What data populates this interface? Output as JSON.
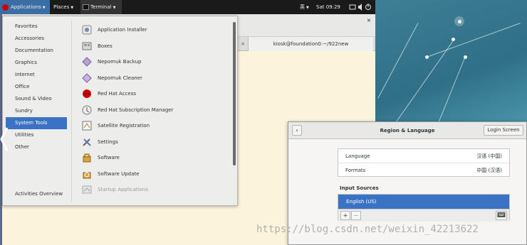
{
  "topbar": {
    "applications_label": "Applications",
    "places_label": "Places",
    "terminal_label": "Terminal",
    "input_method": "英",
    "clock": "Sat 09:29"
  },
  "terminal": {
    "tab_title": "kiosk@foundation0:~/922new",
    "tab_close": "×",
    "close_glyph": "×"
  },
  "menu": {
    "categories": [
      "Favorites",
      "Accessories",
      "Documentation",
      "Graphics",
      "Internet",
      "Office",
      "Sound & Video",
      "Sundry",
      "System Tools",
      "Utilities",
      "Other"
    ],
    "selected_category": "System Tools",
    "activities_overview": "Activities Overview",
    "apps": [
      {
        "label": "Application Installer",
        "icon": "installer-icon",
        "enabled": true
      },
      {
        "label": "Boxes",
        "icon": "boxes-icon",
        "enabled": true
      },
      {
        "label": "Nepomuk Backup",
        "icon": "nepomuk-backup-icon",
        "enabled": true
      },
      {
        "label": "Nepomuk Cleaner",
        "icon": "nepomuk-cleaner-icon",
        "enabled": true
      },
      {
        "label": "Red Hat Access",
        "icon": "redhat-icon",
        "enabled": true
      },
      {
        "label": "Red Hat Subscription Manager",
        "icon": "subscription-icon",
        "enabled": true
      },
      {
        "label": "Satellite Registration",
        "icon": "satellite-icon",
        "enabled": true
      },
      {
        "label": "Settings",
        "icon": "settings-icon",
        "enabled": true
      },
      {
        "label": "Software",
        "icon": "software-icon",
        "enabled": true
      },
      {
        "label": "Software Update",
        "icon": "software-update-icon",
        "enabled": true
      },
      {
        "label": "Startup Applications",
        "icon": "startup-icon",
        "enabled": false
      }
    ]
  },
  "region": {
    "title": "Region & Language",
    "back_glyph": "‹",
    "login_screen": "Login Screen",
    "language_label": "Language",
    "language_value": "汉语 (中国)",
    "formats_label": "Formats",
    "formats_value": "中国 (汉语)",
    "input_sources_label": "Input Sources",
    "input_source": "English (US)",
    "add_glyph": "+",
    "remove_glyph": "−"
  },
  "watermark": "https://blog.csdn.net/weixin_42213622",
  "colors": {
    "accent": "#3b73c4",
    "topbar": "#1a1a1a",
    "terminal_bg": "#fbf3dc"
  }
}
